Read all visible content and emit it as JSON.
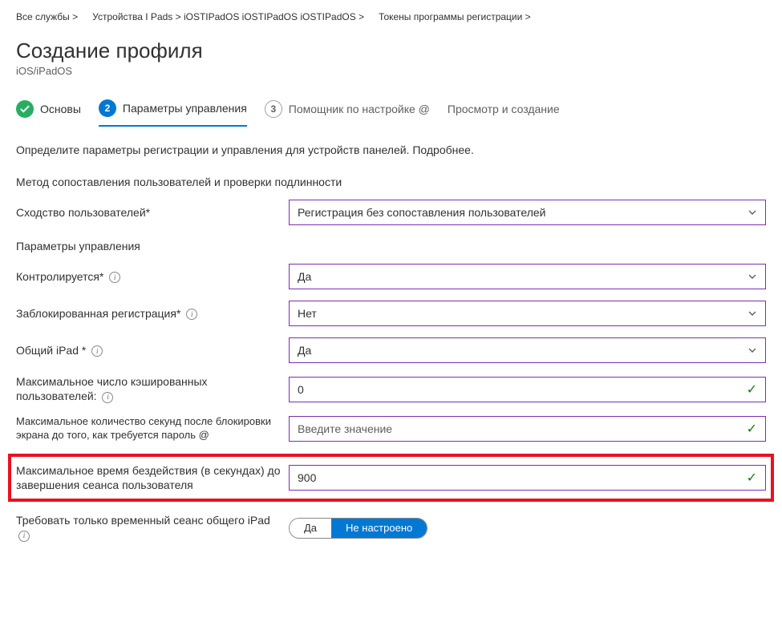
{
  "breadcrumbs": {
    "item0": "Все службы >",
    "item1": "Устройства I Pads > iOSTIPadOS iOSTIPadOS iOSTIPadOS >",
    "item2": "Токены программы регистрации >"
  },
  "header": {
    "title": "Создание профиля",
    "subtitle": "iOS/iPadOS"
  },
  "steps": {
    "s1": {
      "label": "Основы"
    },
    "s2": {
      "num": "2",
      "label": "Параметры управления"
    },
    "s3": {
      "num": "3",
      "label": "Помощник по настройке @"
    },
    "s4": {
      "label": "Просмотр и создание"
    }
  },
  "description": "Определите параметры регистрации и управления для устройств панелей. Подробнее.",
  "sectionUserAuth": "Метод сопоставления пользователей и проверки подлинности",
  "userAffinity": {
    "label": "Сходство пользователей*",
    "value": "Регистрация без сопоставления пользователей"
  },
  "sectionMgmt": "Параметры управления",
  "supervised": {
    "label": "Контролируется*",
    "value": "Да"
  },
  "lockedEnrollment": {
    "label": "Заблокированная регистрация*",
    "value": "Нет"
  },
  "sharedIpad": {
    "label": "Общий iPad *",
    "value": "Да"
  },
  "maxCachedUsers": {
    "label": "Максимальное число кэшированных пользователей:",
    "value": "0"
  },
  "maxSecondsAfterLock": {
    "label": "Максимальное количество секунд после блокировки экрана до того, как требуется пароль @",
    "placeholder": "Введите значение"
  },
  "maxIdleTime": {
    "label": "Максимальное время бездействия (в секундах) до завершения сеанса пользователя",
    "value": "900"
  },
  "tempSessionOnly": {
    "label": "Требовать только временный сеанс общего iPad",
    "option1": "Да",
    "option2": "Не настроено"
  }
}
